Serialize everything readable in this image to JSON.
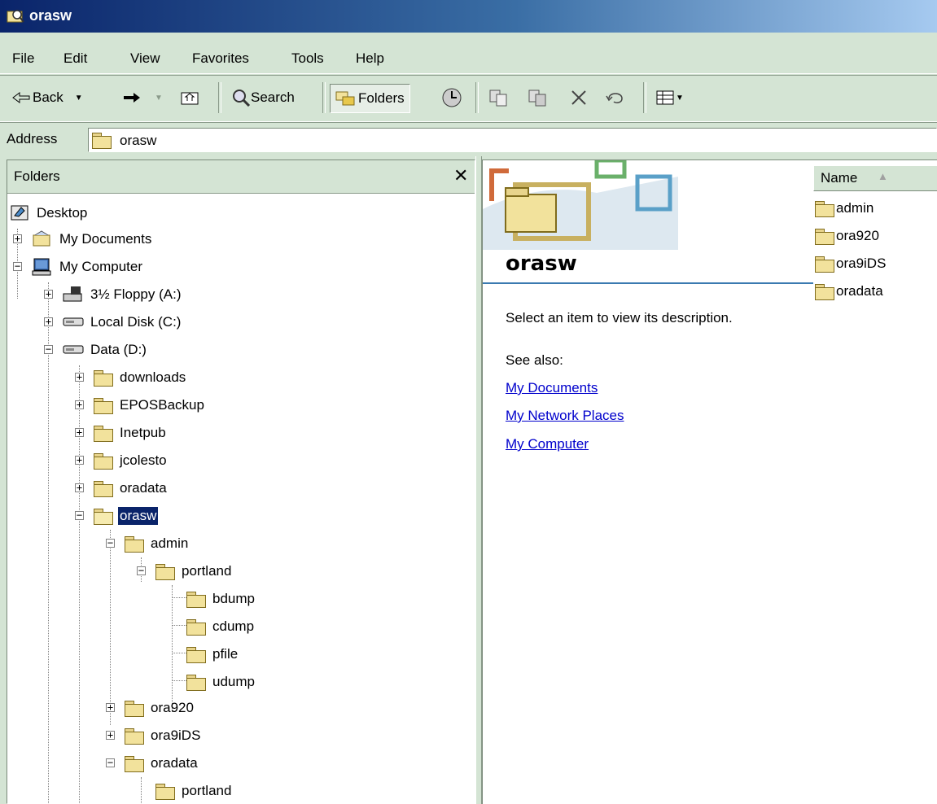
{
  "window": {
    "title": "orasw"
  },
  "menu": {
    "items": [
      {
        "label": "File"
      },
      {
        "label": "Edit"
      },
      {
        "label": "View"
      },
      {
        "label": "Favorites"
      },
      {
        "label": "Tools"
      },
      {
        "label": "Help"
      }
    ]
  },
  "toolbar": {
    "back_label": "Back",
    "search_label": "Search",
    "folders_label": "Folders"
  },
  "address": {
    "label": "Address",
    "value": "orasw"
  },
  "folders_pane": {
    "title": "Folders",
    "close_glyph": "✕",
    "tree": [
      {
        "label": "Desktop"
      },
      {
        "label": "My Documents"
      },
      {
        "label": "My Computer"
      },
      {
        "label": "3½ Floppy (A:)"
      },
      {
        "label": "Local Disk (C:)"
      },
      {
        "label": "Data (D:)"
      },
      {
        "label": "downloads"
      },
      {
        "label": "EPOSBackup"
      },
      {
        "label": "Inetpub"
      },
      {
        "label": "jcolesto"
      },
      {
        "label": "oradata"
      },
      {
        "label": "orasw"
      },
      {
        "label": "admin"
      },
      {
        "label": "portland"
      },
      {
        "label": "bdump"
      },
      {
        "label": "cdump"
      },
      {
        "label": "pfile"
      },
      {
        "label": "udump"
      },
      {
        "label": "ora920"
      },
      {
        "label": "ora9iDS"
      },
      {
        "label": "oradata"
      },
      {
        "label": "portland"
      }
    ]
  },
  "content": {
    "title": "orasw",
    "description": "Select an item to view its description.",
    "see_also_label": "See also:",
    "links": [
      {
        "label": "My Documents"
      },
      {
        "label": "My Network Places"
      },
      {
        "label": "My Computer"
      }
    ],
    "column_header": "Name",
    "files": [
      {
        "label": "admin"
      },
      {
        "label": "ora920"
      },
      {
        "label": "ora9iDS"
      },
      {
        "label": "oradata"
      }
    ]
  }
}
